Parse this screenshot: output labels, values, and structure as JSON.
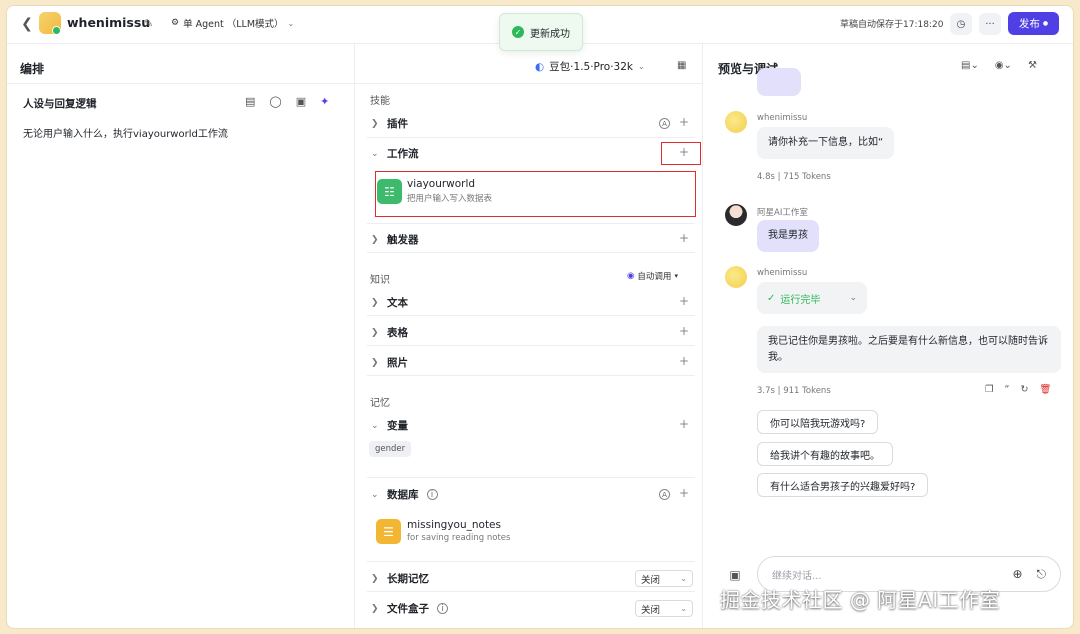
{
  "topbar": {
    "app_name": "whenimissu",
    "agent_mode": "单 Agent （LLM模式）",
    "toast": "更新成功",
    "autosave": "草稿自动保存于17:18:20",
    "more": "···",
    "publish": "发布"
  },
  "left": {
    "title": "编排",
    "persona_title": "人设与回复逻辑",
    "persona_text": "无论用户输入什么，执行viayourworld工作流"
  },
  "mid": {
    "model": "豆包·1.5·Pro·32k",
    "skills_label": "技能",
    "plugins": "插件",
    "workflow": "工作流",
    "workflow_item": {
      "name": "viayourworld",
      "desc": "把用户输入写入数据表"
    },
    "triggers": "触发器",
    "knowledge_label": "知识",
    "auto_call": "自动调用",
    "text": "文本",
    "table": "表格",
    "photo": "照片",
    "memory_label": "记忆",
    "variables": "变量",
    "variable_tag": "gender",
    "database": "数据库",
    "db_item": {
      "name": "missingyou_notes",
      "desc": "for saving reading notes"
    },
    "long_memory": "长期记忆",
    "long_memory_value": "关闭",
    "file_box": "文件盒子",
    "file_box_value": "关闭"
  },
  "right": {
    "title": "预览与调试",
    "msg1_sender": "whenimissu",
    "msg1_text": "请你补充一下信息，比如“",
    "msg1_meta": "4.8s  |  715 Tokens",
    "msg2_sender": "阿星AI工作室",
    "msg2_text": "我是男孩",
    "msg3_sender": "whenimissu",
    "run_status": "运行完毕",
    "msg3_text": "我已记住你是男孩啦。之后要是有什么新信息，也可以随时告诉我。",
    "msg3_meta": "3.7s  |  911 Tokens",
    "suggestions": [
      "你可以陪我玩游戏吗?",
      "给我讲个有趣的故事吧。",
      "有什么适合男孩子的兴趣爱好吗?"
    ],
    "input_placeholder": "继续对话..."
  },
  "watermark": "掘金技术社区 @ 阿星AI工作室"
}
